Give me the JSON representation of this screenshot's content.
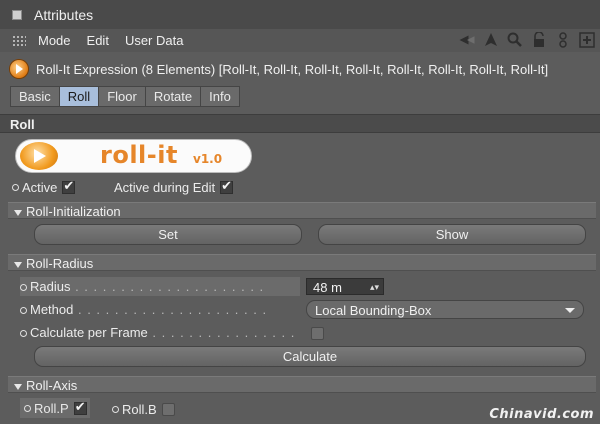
{
  "window": {
    "title": "Attributes"
  },
  "menu": {
    "items": [
      "Mode",
      "Edit",
      "User Data"
    ]
  },
  "toolbar": {
    "icons": [
      "back-arrow-icon",
      "up-arrow-icon",
      "search-icon",
      "lock-icon",
      "link-icon",
      "new-panel-icon"
    ]
  },
  "object": {
    "title": "Roll-It Expression (8 Elements) [Roll-It, Roll-It, Roll-It, Roll-It, Roll-It, Roll-It, Roll-It, Roll-It]"
  },
  "tabs": [
    {
      "label": "Basic",
      "active": false
    },
    {
      "label": "Roll",
      "active": true
    },
    {
      "label": "Floor",
      "active": false
    },
    {
      "label": "Rotate",
      "active": false
    },
    {
      "label": "Info",
      "active": false
    }
  ],
  "section": {
    "title": "Roll"
  },
  "logo": {
    "text": "roll-it",
    "version": "v1.0"
  },
  "options": {
    "active_label": "Active",
    "active_checked": true,
    "active_edit_label": "Active during Edit",
    "active_edit_checked": true
  },
  "roll_init": {
    "title": "Roll-Initialization",
    "set_label": "Set",
    "show_label": "Show"
  },
  "roll_radius": {
    "title": "Roll-Radius",
    "radius_label": "Radius",
    "radius_value": "48 m",
    "method_label": "Method",
    "method_value": "Local Bounding-Box",
    "calc_per_frame_label": "Calculate per Frame",
    "calc_per_frame_checked": false,
    "calculate_label": "Calculate"
  },
  "roll_axis": {
    "title": "Roll-Axis",
    "rollp_label": "Roll.P",
    "rollp_checked": true,
    "rollb_label": "Roll.B",
    "rollb_checked": false
  },
  "watermark": "Chinavid.com"
}
